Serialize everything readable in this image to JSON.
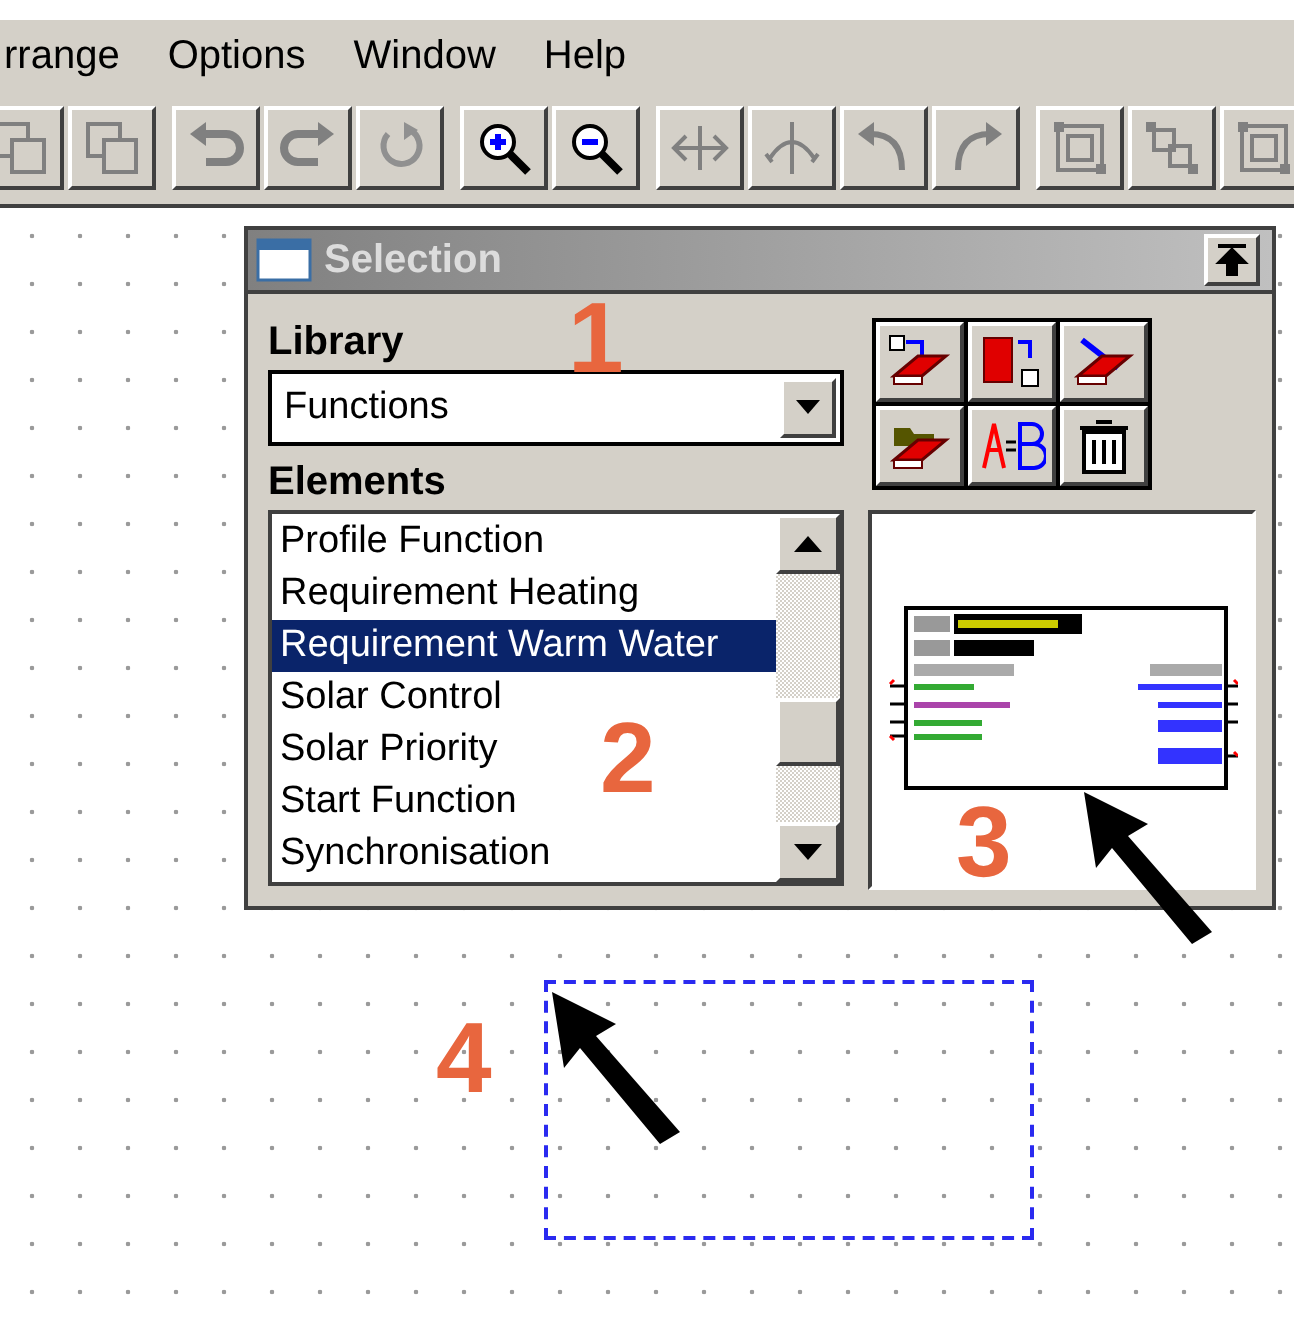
{
  "menu": [
    "rrange",
    "Options",
    "Window",
    "Help"
  ],
  "panel": {
    "title": "Selection",
    "library": {
      "label": "Library",
      "value": "Functions"
    },
    "elements": {
      "label": "Elements",
      "items": [
        {
          "label": "Profile Function",
          "selected": false
        },
        {
          "label": "Requirement Heating",
          "selected": false
        },
        {
          "label": "Requirement Warm Water",
          "selected": true
        },
        {
          "label": "Solar Control",
          "selected": false
        },
        {
          "label": "Solar Priority",
          "selected": false
        },
        {
          "label": "Start Function",
          "selected": false
        },
        {
          "label": "Synchronisation",
          "selected": false
        }
      ]
    }
  },
  "annotations": [
    "1",
    "2",
    "3",
    "4"
  ]
}
